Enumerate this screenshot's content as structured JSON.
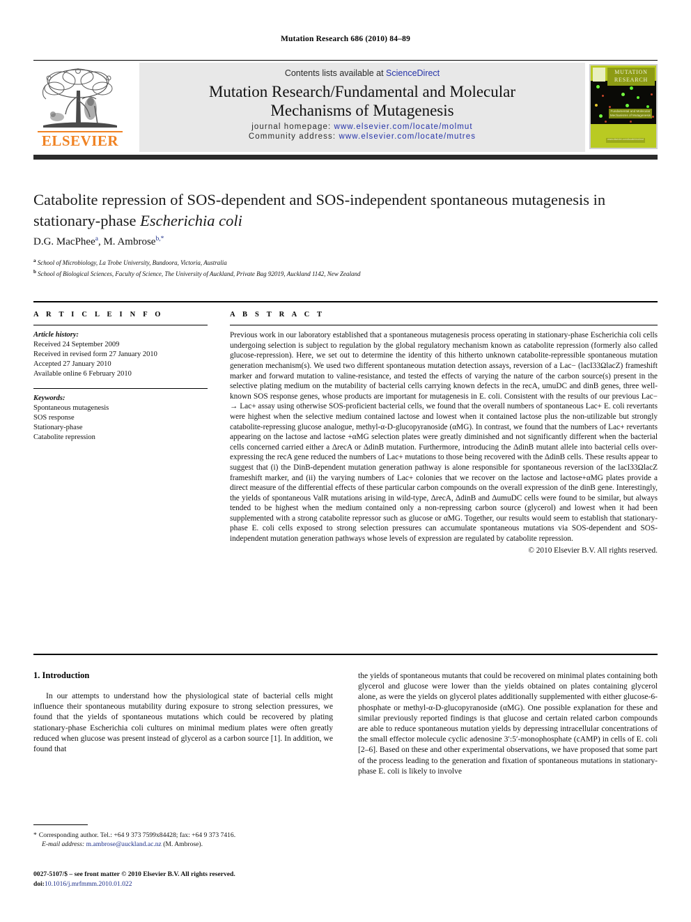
{
  "masthead": {
    "running_head": "Mutation Research 686 (2010) 84–89"
  },
  "header": {
    "contents_prefix": "Contents lists available at ",
    "sciencedirect": "ScienceDirect",
    "journal_title_line1": "Mutation Research/Fundamental and Molecular",
    "journal_title_line2": "Mechanisms of Mutagenesis",
    "homepage_label": "journal homepage:",
    "homepage_url": "www.elsevier.com/locate/molmut",
    "community_label": "Community address:",
    "community_url": "www.elsevier.com/locate/mutres",
    "publisher_wordmark": "ELSEVIER",
    "cover": {
      "title_line1": "MUTATION",
      "title_line2": "RESEARCH",
      "sub_line1": "Fundamental and Molecular",
      "sub_line2": "Mechanisms of Mutagenesis",
      "footer": "www.elsevier.com/locate/molmut"
    },
    "accent_orange": "#f08222",
    "link_blue": "#2432a8",
    "band_gray": "#e8e8e8",
    "cover_green": "#b9ca22"
  },
  "article": {
    "title": "Catabolite repression of SOS-dependent and SOS-independent spontaneous mutagenesis in stationary-phase Escherichia coli",
    "title_plain_1": "Catabolite repression of SOS-dependent and SOS-independent spontaneous",
    "title_plain_2": "mutagenesis in stationary-phase ",
    "title_italic": "Escherichia coli",
    "authors": "D.G. MacPhee",
    "author1": "D.G. MacPhee",
    "author1_sup": "a",
    "author2": ", M. Ambrose",
    "author2_sup": "b,*",
    "affiliation_a_sup": "a",
    "affiliation_a": "School of Microbiology, La Trobe University, Bundoora, Victoria, Australia",
    "affiliation_b_sup": "b",
    "affiliation_b": "School of Biological Sciences, Faculty of Science, The University of Auckland, Private Bag 92019, Auckland 1142, New Zealand"
  },
  "article_info": {
    "heading": "A R T I C L E   I N F O",
    "history_label": "Article history:",
    "history": [
      "Received 24 September 2009",
      "Received in revised form 27 January 2010",
      "Accepted 27 January 2010",
      "Available online 6 February 2010"
    ],
    "keywords_label": "Keywords:",
    "keywords": [
      "Spontaneous mutagenesis",
      "SOS response",
      "Stationary-phase",
      "Catabolite repression"
    ]
  },
  "abstract": {
    "heading": "A B S T R A C T",
    "text": "Previous work in our laboratory established that a spontaneous mutagenesis process operating in stationary-phase Escherichia coli cells undergoing selection is subject to regulation by the global regulatory mechanism known as catabolite repression (formerly also called glucose-repression). Here, we set out to determine the identity of this hitherto unknown catabolite-repressible spontaneous mutation generation mechanism(s). We used two different spontaneous mutation detection assays, reversion of a Lac− (lacI33ΩlacZ) frameshift marker and forward mutation to valine-resistance, and tested the effects of varying the nature of the carbon source(s) present in the selective plating medium on the mutability of bacterial cells carrying known defects in the recA, umuDC and dinB genes, three well-known SOS response genes, whose products are important for mutagenesis in E. coli. Consistent with the results of our previous Lac− → Lac+ assay using otherwise SOS-proficient bacterial cells, we found that the overall numbers of spontaneous Lac+ E. coli revertants were highest when the selective medium contained lactose and lowest when it contained lactose plus the non-utilizable but strongly catabolite-repressing glucose analogue, methyl-α-D-glucopyranoside (αMG). In contrast, we found that the numbers of Lac+ revertants appearing on the lactose and lactose +αMG selection plates were greatly diminished and not significantly different when the bacterial cells concerned carried either a ΔrecA or ΔdinB mutation. Furthermore, introducing the ΔdinB mutant allele into bacterial cells over-expressing the recA gene reduced the numbers of Lac+ mutations to those being recovered with the ΔdinB cells. These results appear to suggest that (i) the DinB-dependent mutation generation pathway is alone responsible for spontaneous reversion of the lacI33ΩlacZ frameshift marker, and (ii) the varying numbers of Lac+ colonies that we recover on the lactose and lactose+αMG plates provide a direct measure of the differential effects of these particular carbon compounds on the overall expression of the dinB gene. Interestingly, the yields of spontaneous ValR mutations arising in wild-type, ΔrecA, ΔdinB and ΔumuDC cells were found to be similar, but always tended to be highest when the medium contained only a non-repressing carbon source (glycerol) and lowest when it had been supplemented with a strong catabolite repressor such as glucose or αMG. Together, our results would seem to establish that stationary-phase E. coli cells exposed to strong selection pressures can accumulate spontaneous mutations via SOS-dependent and SOS-independent mutation generation pathways whose levels of expression are regulated by catabolite repression.",
    "copyright": "© 2010 Elsevier B.V. All rights reserved."
  },
  "introduction": {
    "heading": "1.  Introduction",
    "paragraph_left": "In our attempts to understand how the physiological state of bacterial cells might influence their spontaneous mutability during exposure to strong selection pressures, we found that the yields of spontaneous mutations which could be recovered by plating stationary-phase Escherichia coli cultures on minimal medium plates were often greatly reduced when glucose was present instead of glycerol as a carbon source [1]. In addition, we found that",
    "paragraph_right": "the yields of spontaneous mutants that could be recovered on minimal plates containing both glycerol and glucose were lower than the yields obtained on plates containing glycerol alone, as were the yields on glycerol plates additionally supplemented with either glucose-6-phosphate or methyl-α-D-glucopyranoside (αMG). One possible explanation for these and similar previously reported findings is that glucose and certain related carbon compounds are able to reduce spontaneous mutation yields by depressing intracellular concentrations of the small effector molecule cyclic adenosine 3′:5′-monophosphate (cAMP) in cells of E. coli [2–6]. Based on these and other experimental observations, we have proposed that some part of the process leading to the generation and fixation of spontaneous mutations in stationary-phase E. coli is likely to involve"
  },
  "footnote": {
    "star": "*",
    "corresponding": "Corresponding author. Tel.: +64 9 373 7599x84428; fax: +64 9 373 7416.",
    "email_label": "E-mail address:",
    "email": "m.ambrose@auckland.ac.nz",
    "email_suffix": "(M. Ambrose)."
  },
  "issn_line": {
    "front_matter": "0027-5107/$ – see front matter © 2010 Elsevier B.V. All rights reserved.",
    "doi_label": "doi:",
    "doi": "10.1016/j.mrfmmm.2010.01.022"
  }
}
